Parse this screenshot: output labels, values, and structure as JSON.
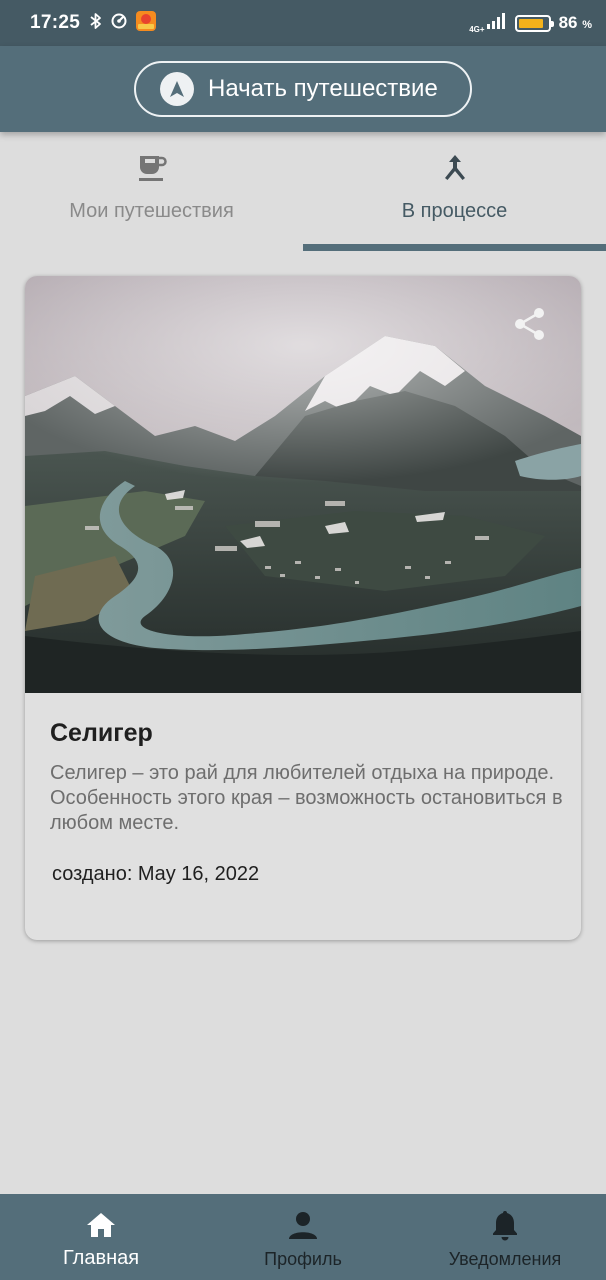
{
  "status_bar": {
    "time": "17:25",
    "network": "4G+",
    "battery_percent": "86",
    "percent_sign": "%",
    "battery_level": 0.86
  },
  "app_bar": {
    "start_button_label": "Начать путешествие",
    "start_icon": "navigation-arrow-icon"
  },
  "tabs": [
    {
      "label": "Мои путешествия",
      "icon": "coffee-cup-icon",
      "active": false
    },
    {
      "label": "В процессе",
      "icon": "merge-arrows-icon",
      "active": true
    }
  ],
  "trip_card": {
    "title": "Селигер",
    "description": "Селигер – это рай для любителей отдыха на природе. Особенность этого края – возможность остановиться в любом месте.",
    "created": "создано: May 16, 2022",
    "image": "mountain-lake-landscape",
    "share_icon": "share-icon"
  },
  "bottom_nav": [
    {
      "label": "Главная",
      "icon": "home-icon",
      "active": true
    },
    {
      "label": "Профиль",
      "icon": "person-icon",
      "active": false
    },
    {
      "label": "Уведомления",
      "icon": "bell-icon",
      "active": false
    }
  ],
  "colors": {
    "status_bar": "#455a64",
    "primary": "#546e7a",
    "background": "#dddddd",
    "card": "#e0e0e0",
    "battery": "#f3b21b"
  }
}
